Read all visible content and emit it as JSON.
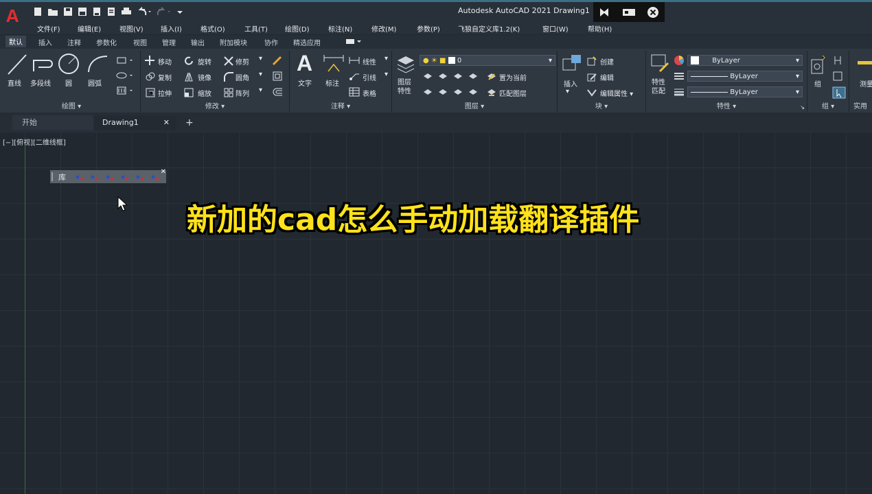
{
  "app": {
    "logo": "A",
    "title": "Autodesk AutoCAD 2021    Drawing1",
    "qat_icons": [
      "new-icon",
      "open-icon",
      "save-icon",
      "save-as-icon",
      "web-icon",
      "publish-icon",
      "plot-icon",
      "undo-icon",
      "redo-icon",
      "customize-icon"
    ],
    "window_controls": [
      "send-icon",
      "screen-icon",
      "close-icon"
    ]
  },
  "menubar": [
    "文件(F)",
    "编辑(E)",
    "视图(V)",
    "插入(I)",
    "格式(O)",
    "工具(T)",
    "绘图(D)",
    "标注(N)",
    "修改(M)",
    "参数(P)",
    "飞狼自定义库1.2(K)",
    "窗口(W)",
    "帮助(H)"
  ],
  "ribbon_tabs": [
    "默认",
    "插入",
    "注释",
    "参数化",
    "视图",
    "管理",
    "输出",
    "附加模块",
    "协作",
    "精选应用"
  ],
  "panels": {
    "draw": {
      "label": "绘图 ▾",
      "tools": [
        "直线",
        "多段线",
        "圆",
        "圆弧"
      ]
    },
    "modify": {
      "label": "修改 ▾",
      "tools": [
        "移动",
        "旋转",
        "修剪",
        "复制",
        "镜像",
        "圆角",
        "拉伸",
        "缩放",
        "阵列"
      ]
    },
    "annotation": {
      "label": "注释 ▾",
      "tools": [
        "文字",
        "标注",
        "线性",
        "引线",
        "表格"
      ]
    },
    "layers": {
      "label": "图层 ▾",
      "button": "图层\n特性",
      "current_layer": "0",
      "tools": [
        "置为当前",
        "匹配图层"
      ]
    },
    "block": {
      "label": "块 ▾",
      "insert": "插入",
      "tools": [
        "创建",
        "编辑",
        "编辑属性 ▾"
      ]
    },
    "properties": {
      "label": "特性 ▾",
      "match": "特性\n匹配",
      "color": "ByLayer",
      "linetype": "ByLayer",
      "lineweight": "ByLayer"
    },
    "group": {
      "label": "组 ▾",
      "tool": "组"
    },
    "utility": {
      "label": "实用",
      "tool": "测量"
    }
  },
  "doc_tabs": [
    "开始",
    "Drawing1"
  ],
  "viewport_label": "[−][俯视][二维线框]",
  "float_toolbar": {
    "title": "库"
  },
  "overlay_text": "新加的cad怎么手动加载翻译插件"
}
